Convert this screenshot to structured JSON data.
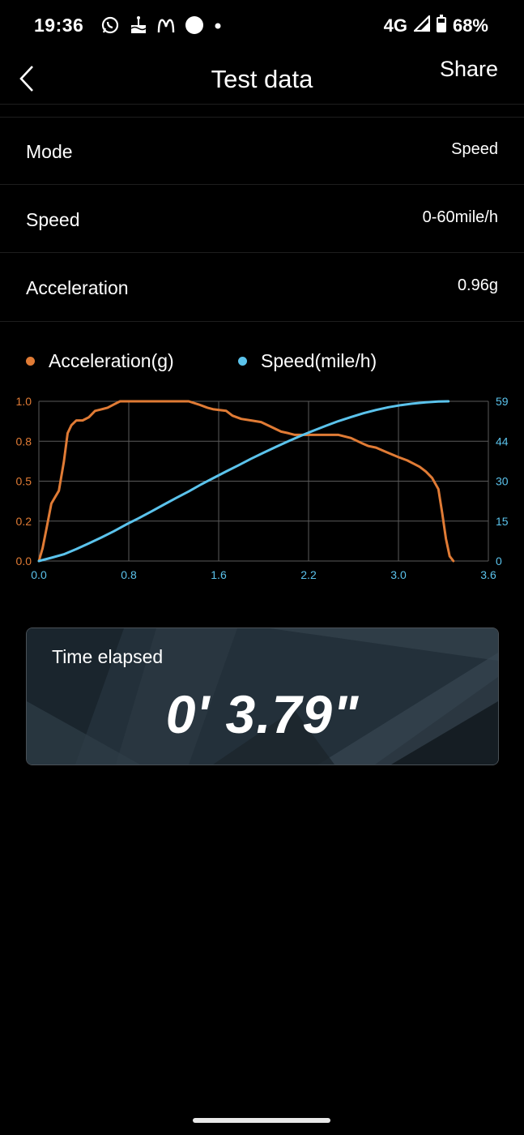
{
  "status_bar": {
    "time": "19:36",
    "network": "4G",
    "battery": "68%",
    "icons": [
      "whatsapp-icon",
      "cake-icon",
      "mcdonalds-icon",
      "circle-icon",
      "dot-icon",
      "signal-icon",
      "battery-icon"
    ]
  },
  "header": {
    "title": "Test data",
    "share_label": "Share",
    "back_icon": "chevron-left-icon"
  },
  "rows": [
    {
      "label": "Mode",
      "value": "Speed"
    },
    {
      "label": "Speed",
      "value": "0-60mile/h"
    },
    {
      "label": "Acceleration",
      "value": "0.96g"
    }
  ],
  "colors": {
    "acceleration": "#e07b35",
    "speed": "#5bc3ec",
    "grid": "#5a5a5a",
    "background": "#000000"
  },
  "chart_data": {
    "type": "line",
    "x_ticks": [
      "0.0",
      "0.8",
      "1.6",
      "2.2",
      "3.0",
      "3.6"
    ],
    "y_left_ticks": [
      "0.0",
      "0.2",
      "0.5",
      "0.8",
      "1.0"
    ],
    "y_right_ticks": [
      "0",
      "15",
      "30",
      "44",
      "59"
    ],
    "xlim": [
      0,
      3.6
    ],
    "y_left_lim": [
      0,
      1.0
    ],
    "y_right_lim": [
      0,
      59
    ],
    "grid": true,
    "legend_position": "top-left",
    "series": [
      {
        "name": "Acceleration(g)",
        "axis": "left",
        "x": [
          0.0,
          0.03,
          0.06,
          0.1,
          0.13,
          0.16,
          0.2,
          0.23,
          0.26,
          0.3,
          0.35,
          0.4,
          0.45,
          0.5,
          0.55,
          0.6,
          0.65,
          0.7,
          0.75,
          0.8,
          0.9,
          1.0,
          1.1,
          1.2,
          1.28,
          1.35,
          1.4,
          1.5,
          1.55,
          1.62,
          1.7,
          1.78,
          1.86,
          1.94,
          2.0,
          2.05,
          2.1,
          2.2,
          2.3,
          2.4,
          2.5,
          2.58,
          2.64,
          2.7,
          2.76,
          2.82,
          2.88,
          2.95,
          3.0,
          3.05,
          3.1,
          3.15,
          3.2,
          3.23,
          3.26,
          3.29,
          3.32
        ],
        "values": [
          0.0,
          0.08,
          0.2,
          0.36,
          0.4,
          0.44,
          0.62,
          0.8,
          0.85,
          0.88,
          0.88,
          0.9,
          0.94,
          0.95,
          0.96,
          0.98,
          1.0,
          1.0,
          1.0,
          1.0,
          1.0,
          1.0,
          1.0,
          1.0,
          0.98,
          0.96,
          0.95,
          0.94,
          0.91,
          0.89,
          0.88,
          0.87,
          0.84,
          0.81,
          0.8,
          0.79,
          0.79,
          0.79,
          0.79,
          0.79,
          0.77,
          0.74,
          0.72,
          0.71,
          0.69,
          0.67,
          0.65,
          0.63,
          0.61,
          0.59,
          0.56,
          0.52,
          0.45,
          0.3,
          0.14,
          0.03,
          0.0
        ]
      },
      {
        "name": "Speed(mile/h)",
        "axis": "right",
        "x": [
          0.0,
          0.1,
          0.2,
          0.3,
          0.4,
          0.5,
          0.6,
          0.7,
          0.8,
          0.9,
          1.0,
          1.1,
          1.2,
          1.3,
          1.4,
          1.5,
          1.6,
          1.7,
          1.8,
          1.9,
          2.0,
          2.1,
          2.2,
          2.3,
          2.4,
          2.5,
          2.6,
          2.7,
          2.8,
          2.9,
          3.0,
          3.1,
          3.2,
          3.28
        ],
        "values": [
          0.0,
          1.2,
          2.5,
          4.4,
          6.5,
          8.7,
          11.0,
          13.5,
          15.8,
          18.3,
          20.8,
          23.3,
          25.7,
          28.3,
          30.7,
          33.1,
          35.4,
          37.8,
          40.0,
          42.2,
          44.3,
          46.3,
          48.2,
          50.0,
          51.7,
          53.2,
          54.6,
          55.8,
          56.8,
          57.6,
          58.2,
          58.6,
          58.9,
          59.0
        ]
      }
    ]
  },
  "time_card": {
    "label": "Time elapsed",
    "value": "0' 3.79\""
  }
}
